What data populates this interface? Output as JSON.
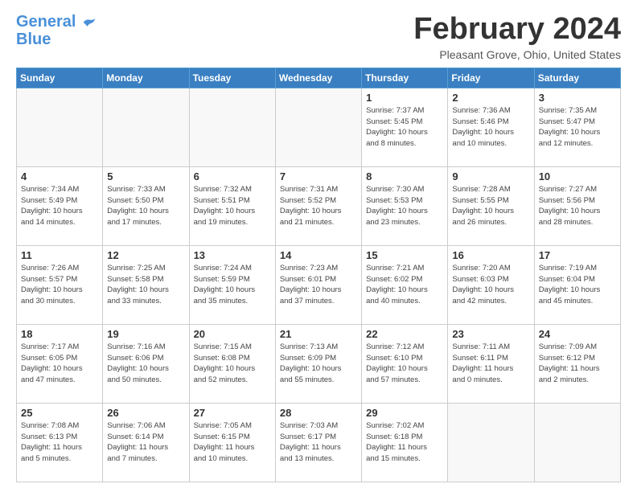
{
  "logo": {
    "line1": "General",
    "line2": "Blue"
  },
  "title": "February 2024",
  "location": "Pleasant Grove, Ohio, United States",
  "days_of_week": [
    "Sunday",
    "Monday",
    "Tuesday",
    "Wednesday",
    "Thursday",
    "Friday",
    "Saturday"
  ],
  "weeks": [
    [
      {
        "day": "",
        "info": ""
      },
      {
        "day": "",
        "info": ""
      },
      {
        "day": "",
        "info": ""
      },
      {
        "day": "",
        "info": ""
      },
      {
        "day": "1",
        "info": "Sunrise: 7:37 AM\nSunset: 5:45 PM\nDaylight: 10 hours\nand 8 minutes."
      },
      {
        "day": "2",
        "info": "Sunrise: 7:36 AM\nSunset: 5:46 PM\nDaylight: 10 hours\nand 10 minutes."
      },
      {
        "day": "3",
        "info": "Sunrise: 7:35 AM\nSunset: 5:47 PM\nDaylight: 10 hours\nand 12 minutes."
      }
    ],
    [
      {
        "day": "4",
        "info": "Sunrise: 7:34 AM\nSunset: 5:49 PM\nDaylight: 10 hours\nand 14 minutes."
      },
      {
        "day": "5",
        "info": "Sunrise: 7:33 AM\nSunset: 5:50 PM\nDaylight: 10 hours\nand 17 minutes."
      },
      {
        "day": "6",
        "info": "Sunrise: 7:32 AM\nSunset: 5:51 PM\nDaylight: 10 hours\nand 19 minutes."
      },
      {
        "day": "7",
        "info": "Sunrise: 7:31 AM\nSunset: 5:52 PM\nDaylight: 10 hours\nand 21 minutes."
      },
      {
        "day": "8",
        "info": "Sunrise: 7:30 AM\nSunset: 5:53 PM\nDaylight: 10 hours\nand 23 minutes."
      },
      {
        "day": "9",
        "info": "Sunrise: 7:28 AM\nSunset: 5:55 PM\nDaylight: 10 hours\nand 26 minutes."
      },
      {
        "day": "10",
        "info": "Sunrise: 7:27 AM\nSunset: 5:56 PM\nDaylight: 10 hours\nand 28 minutes."
      }
    ],
    [
      {
        "day": "11",
        "info": "Sunrise: 7:26 AM\nSunset: 5:57 PM\nDaylight: 10 hours\nand 30 minutes."
      },
      {
        "day": "12",
        "info": "Sunrise: 7:25 AM\nSunset: 5:58 PM\nDaylight: 10 hours\nand 33 minutes."
      },
      {
        "day": "13",
        "info": "Sunrise: 7:24 AM\nSunset: 5:59 PM\nDaylight: 10 hours\nand 35 minutes."
      },
      {
        "day": "14",
        "info": "Sunrise: 7:23 AM\nSunset: 6:01 PM\nDaylight: 10 hours\nand 37 minutes."
      },
      {
        "day": "15",
        "info": "Sunrise: 7:21 AM\nSunset: 6:02 PM\nDaylight: 10 hours\nand 40 minutes."
      },
      {
        "day": "16",
        "info": "Sunrise: 7:20 AM\nSunset: 6:03 PM\nDaylight: 10 hours\nand 42 minutes."
      },
      {
        "day": "17",
        "info": "Sunrise: 7:19 AM\nSunset: 6:04 PM\nDaylight: 10 hours\nand 45 minutes."
      }
    ],
    [
      {
        "day": "18",
        "info": "Sunrise: 7:17 AM\nSunset: 6:05 PM\nDaylight: 10 hours\nand 47 minutes."
      },
      {
        "day": "19",
        "info": "Sunrise: 7:16 AM\nSunset: 6:06 PM\nDaylight: 10 hours\nand 50 minutes."
      },
      {
        "day": "20",
        "info": "Sunrise: 7:15 AM\nSunset: 6:08 PM\nDaylight: 10 hours\nand 52 minutes."
      },
      {
        "day": "21",
        "info": "Sunrise: 7:13 AM\nSunset: 6:09 PM\nDaylight: 10 hours\nand 55 minutes."
      },
      {
        "day": "22",
        "info": "Sunrise: 7:12 AM\nSunset: 6:10 PM\nDaylight: 10 hours\nand 57 minutes."
      },
      {
        "day": "23",
        "info": "Sunrise: 7:11 AM\nSunset: 6:11 PM\nDaylight: 11 hours\nand 0 minutes."
      },
      {
        "day": "24",
        "info": "Sunrise: 7:09 AM\nSunset: 6:12 PM\nDaylight: 11 hours\nand 2 minutes."
      }
    ],
    [
      {
        "day": "25",
        "info": "Sunrise: 7:08 AM\nSunset: 6:13 PM\nDaylight: 11 hours\nand 5 minutes."
      },
      {
        "day": "26",
        "info": "Sunrise: 7:06 AM\nSunset: 6:14 PM\nDaylight: 11 hours\nand 7 minutes."
      },
      {
        "day": "27",
        "info": "Sunrise: 7:05 AM\nSunset: 6:15 PM\nDaylight: 11 hours\nand 10 minutes."
      },
      {
        "day": "28",
        "info": "Sunrise: 7:03 AM\nSunset: 6:17 PM\nDaylight: 11 hours\nand 13 minutes."
      },
      {
        "day": "29",
        "info": "Sunrise: 7:02 AM\nSunset: 6:18 PM\nDaylight: 11 hours\nand 15 minutes."
      },
      {
        "day": "",
        "info": ""
      },
      {
        "day": "",
        "info": ""
      }
    ]
  ]
}
